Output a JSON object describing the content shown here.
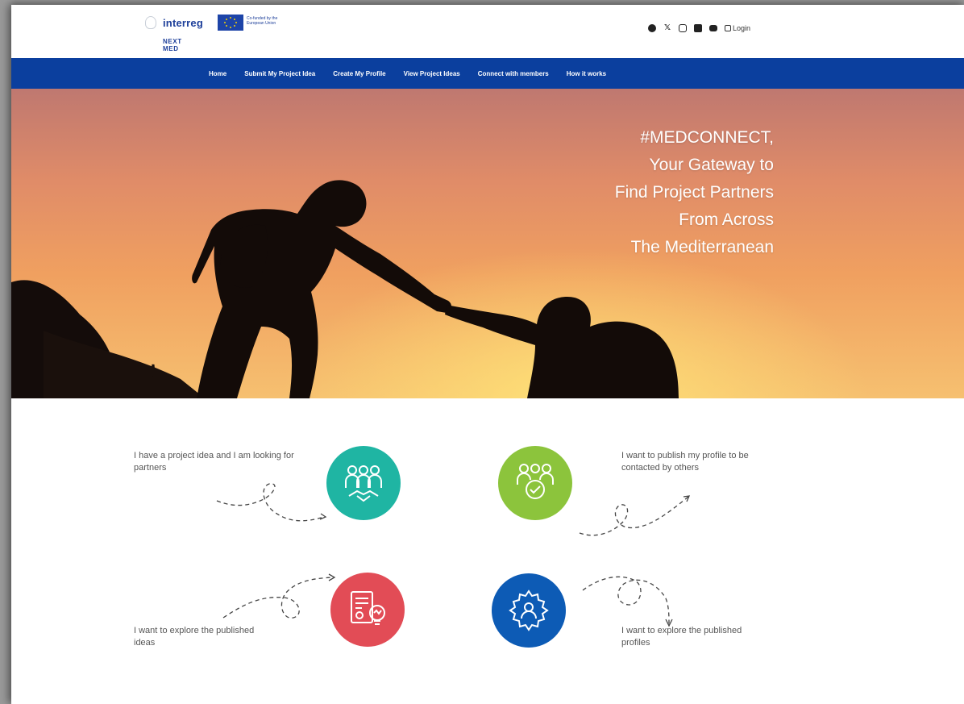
{
  "header": {
    "logo": {
      "brand": "interreg",
      "eu_text": "Co-funded by the European Union",
      "program": "NEXT MED"
    },
    "social": {
      "icons": [
        "facebook-icon",
        "x-icon",
        "instagram-icon",
        "linkedin-icon",
        "youtube-icon"
      ],
      "login_label": "Login"
    }
  },
  "nav": {
    "items": [
      {
        "label": "Home"
      },
      {
        "label": "Submit My Project Idea"
      },
      {
        "label": "Create My Profile"
      },
      {
        "label": "View Project Ideas"
      },
      {
        "label": "Connect with members"
      },
      {
        "label": "How it works"
      }
    ]
  },
  "hero": {
    "lines": [
      "#MEDCONNECT,",
      "Your Gateway to",
      "Find Project Partners",
      "From Across",
      "The Mediterranean"
    ]
  },
  "features": [
    {
      "text": "I have a project idea and I am looking for partners",
      "color": "#1fb5a3",
      "icon": "team-handshake-icon"
    },
    {
      "text": "I want to publish my profile to be contacted by others",
      "color": "#8cc43c",
      "icon": "team-check-icon"
    },
    {
      "text": "I want to explore the published ideas",
      "color": "#e24c56",
      "icon": "document-idea-icon"
    },
    {
      "text": "I want to explore the published profiles",
      "color": "#0d5bb5",
      "icon": "gear-person-icon"
    }
  ],
  "colors": {
    "nav": "#0b3f9e",
    "brand": "#1d3f9a"
  }
}
